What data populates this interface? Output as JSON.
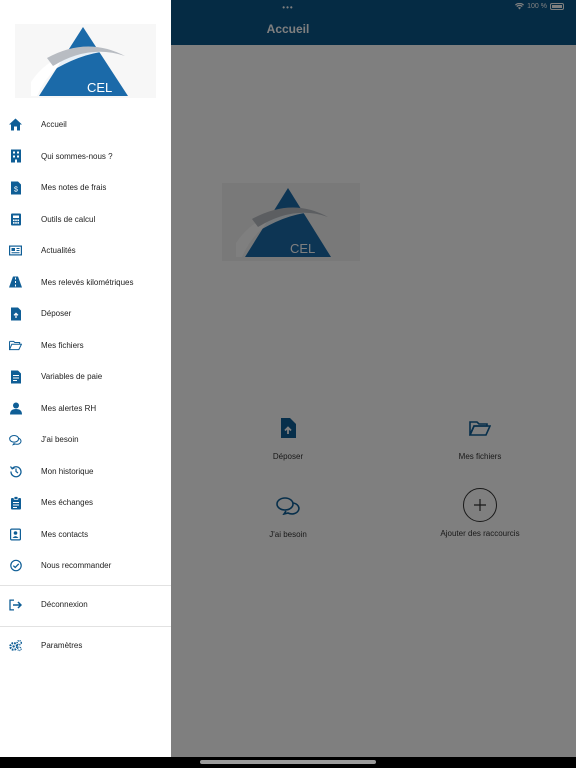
{
  "status_bar": {
    "dots": "•••",
    "battery_text": "100 %"
  },
  "header": {
    "title": "Accueil"
  },
  "drawer": {
    "logo_text": "CEL",
    "items": [
      {
        "label": "Accueil",
        "icon": "home-icon"
      },
      {
        "label": "Qui sommes-nous ?",
        "icon": "building-icon"
      },
      {
        "label": "Mes notes de frais",
        "icon": "receipt-icon"
      },
      {
        "label": "Outils de calcul",
        "icon": "calculator-icon"
      },
      {
        "label": "Actualités",
        "icon": "news-icon"
      },
      {
        "label": "Mes relevés kilométriques",
        "icon": "road-icon"
      },
      {
        "label": "Déposer",
        "icon": "file-upload-icon"
      },
      {
        "label": "Mes fichiers",
        "icon": "folder-open-icon"
      },
      {
        "label": "Variables de paie",
        "icon": "document-icon"
      },
      {
        "label": "Mes alertes RH",
        "icon": "user-alert-icon"
      },
      {
        "label": "J'ai besoin",
        "icon": "chat-bubbles-icon"
      },
      {
        "label": "Mon historique",
        "icon": "history-icon"
      },
      {
        "label": "Mes échanges",
        "icon": "clipboard-icon"
      },
      {
        "label": "Mes contacts",
        "icon": "contact-card-icon"
      },
      {
        "label": "Nous recommander",
        "icon": "check-circle-icon"
      }
    ],
    "logout_label": "Déconnexion",
    "settings_label": "Paramètres"
  },
  "main": {
    "logo_text": "CEL",
    "shortcuts": [
      {
        "label": "Déposer",
        "icon": "file-upload-icon"
      },
      {
        "label": "Mes fichiers",
        "icon": "folder-open-icon"
      },
      {
        "label": "J'ai besoin",
        "icon": "chat-bubbles-icon"
      },
      {
        "label": "Ajouter des raccourcis",
        "icon": "plus-icon"
      }
    ]
  },
  "colors": {
    "brand_blue": "#0a5689",
    "icon_blue": "#0f5e96",
    "drawer_bg": "#ffffff"
  }
}
